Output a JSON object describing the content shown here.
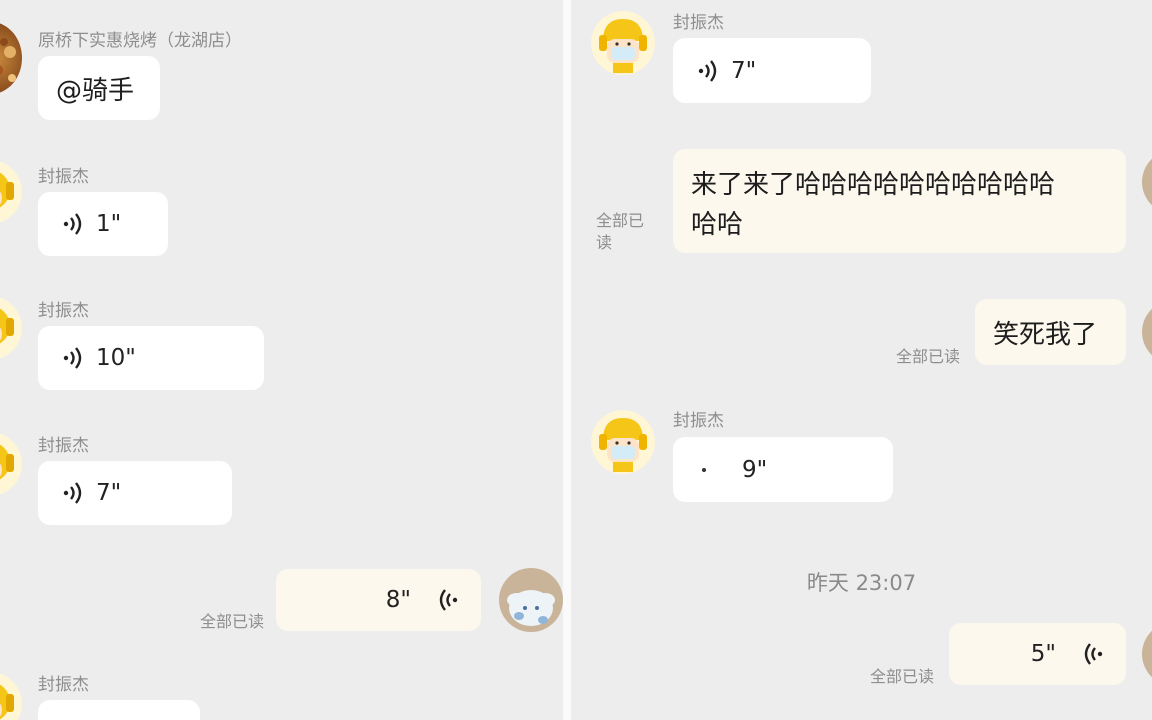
{
  "left": {
    "first_sender": "原桥下实惠烧烤（龙湖店）",
    "first_message": "@骑手",
    "sender_name": "封振杰",
    "voice": [
      {
        "duration": "1\""
      },
      {
        "duration": "10\""
      },
      {
        "duration": "7\""
      }
    ],
    "my_voice": {
      "duration": "8\"",
      "read_status": "全部已读"
    },
    "last_sender": "封振杰"
  },
  "right": {
    "sender_name": "封振杰",
    "voice_top": {
      "duration": "7\""
    },
    "my_message_1": {
      "line1": "来了来了哈哈哈哈哈哈哈哈哈哈",
      "line2": "哈哈",
      "read_status": "全部已读"
    },
    "my_message_2": {
      "text": "笑死我了",
      "read_status": "全部已读"
    },
    "voice_mid": {
      "duration": "9\""
    },
    "timestamp": "昨天 23:07",
    "my_voice": {
      "duration": "5\"",
      "read_status": "全部已读"
    }
  },
  "colors": {
    "background": "#ededed",
    "bubble_other": "#ffffff",
    "bubble_mine": "#fdf8ee",
    "meta_text": "#8e8e8e"
  },
  "icons": [
    "voice-wave-icon",
    "avatar-bbq-shop",
    "avatar-helmet-rider",
    "avatar-plush-toy"
  ]
}
